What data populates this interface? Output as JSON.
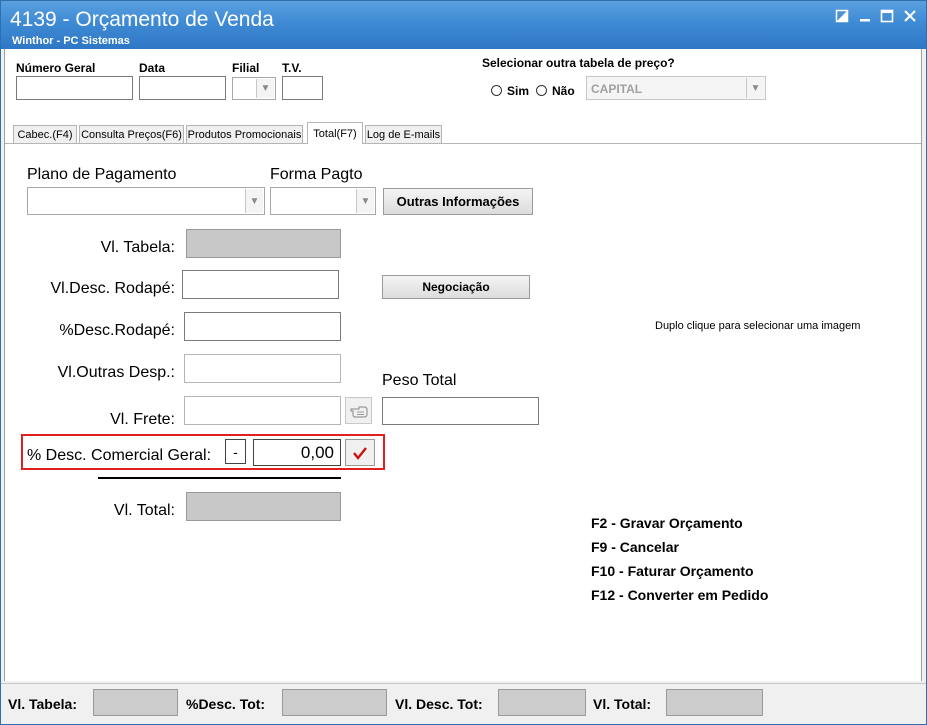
{
  "window": {
    "title": "4139 - Orçamento de Venda",
    "subtitle": "Winthor - PC Sistemas",
    "controls": [
      "restore-icon",
      "minimize-icon",
      "maximize-icon",
      "close-icon"
    ]
  },
  "header": {
    "numero_geral_label": "Número Geral",
    "data_label": "Data",
    "filial_label": "Filial",
    "tv_label": "T.V.",
    "tabela_preco_label": "Selecionar outra tabela de preço?",
    "sim_label": "Sim",
    "nao_label": "Não",
    "tabela_value": "CAPITAL"
  },
  "tabs": [
    {
      "label": "Cabec.(F4)"
    },
    {
      "label": "Consulta Preços(F6)"
    },
    {
      "label": "Produtos Promocionais"
    },
    {
      "label": "Total(F7)"
    },
    {
      "label": "Log de E-mails"
    }
  ],
  "main": {
    "plano_pagamento_label": "Plano de Pagamento",
    "forma_pagto_label": "Forma Pagto",
    "outras_info_button": "Outras Informações",
    "vl_tabela_label": "Vl. Tabela:",
    "vl_desc_rodape_label": "Vl.Desc. Rodapé:",
    "negociacao_button": "Negociação",
    "pct_desc_rodape_label": "%Desc.Rodapé:",
    "image_hint": "Duplo clique para selecionar uma imagem",
    "vl_outras_desp_label": "Vl.Outras Desp.:",
    "peso_total_label": "Peso Total",
    "vl_frete_label": "Vl. Frete:",
    "desc_comercial_label": "% Desc. Comercial Geral:",
    "desc_comercial_sign": "-",
    "desc_comercial_value": "0,00",
    "vl_total_label": "Vl. Total:"
  },
  "shortcuts": [
    "F2 - Gravar Orçamento",
    "F9 - Cancelar",
    "F10 - Faturar Orçamento",
    "F12 - Converter em Pedido"
  ],
  "statusbar": {
    "vl_tabela_label": "Vl. Tabela:",
    "pct_desc_tot_label": "%Desc. Tot:",
    "vl_desc_tot_label": "Vl. Desc. Tot:",
    "vl_total_label": "Vl. Total:"
  },
  "colors": {
    "titlebar": "#3f8ad4",
    "highlight_border": "#e02020",
    "confirm_check": "#cc1111"
  }
}
